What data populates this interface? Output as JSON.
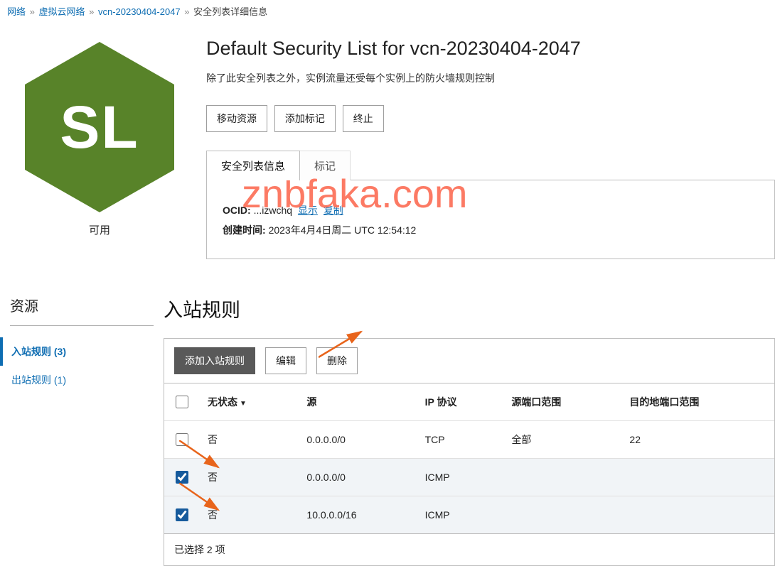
{
  "breadcrumb": {
    "items": [
      "网络",
      "虚拟云网络",
      "vcn-20230404-2047"
    ],
    "current": "安全列表详细信息"
  },
  "hex": {
    "abbr": "SL",
    "status": "可用"
  },
  "header": {
    "title": "Default Security List for vcn-20230404-2047",
    "subtitle": "除了此安全列表之外，实例流量还受每个实例上的防火墙规则控制"
  },
  "actions": {
    "move": "移动资源",
    "tag": "添加标记",
    "terminate": "终止"
  },
  "tabs": {
    "info": "安全列表信息",
    "tags": "标记"
  },
  "info": {
    "ocid_label": "OCID:",
    "ocid_value": "...izwchq",
    "show": "显示",
    "copy": "复制",
    "created_label": "创建时间:",
    "created_value": "2023年4月4日周二 UTC 12:54:12"
  },
  "watermark": "znbfaka.com",
  "sidebar": {
    "title": "资源",
    "items": [
      {
        "label": "入站规则 (3)",
        "active": true
      },
      {
        "label": "出站规则 (1)",
        "active": false
      }
    ]
  },
  "rules": {
    "section_title": "入站规则",
    "toolbar": {
      "add": "添加入站规则",
      "edit": "编辑",
      "delete": "删除"
    },
    "columns": {
      "stateless": "无状态",
      "source": "源",
      "protocol": "IP 协议",
      "src_port": "源端口范围",
      "dst_port": "目的地端口范围"
    },
    "rows": [
      {
        "checked": false,
        "stateless": "否",
        "source": "0.0.0.0/0",
        "protocol": "TCP",
        "src_port": "全部",
        "dst_port": "22"
      },
      {
        "checked": true,
        "stateless": "否",
        "source": "0.0.0.0/0",
        "protocol": "ICMP",
        "src_port": "",
        "dst_port": ""
      },
      {
        "checked": true,
        "stateless": "否",
        "source": "10.0.0.0/16",
        "protocol": "ICMP",
        "src_port": "",
        "dst_port": ""
      }
    ],
    "selected_text": "已选择 2 项"
  }
}
